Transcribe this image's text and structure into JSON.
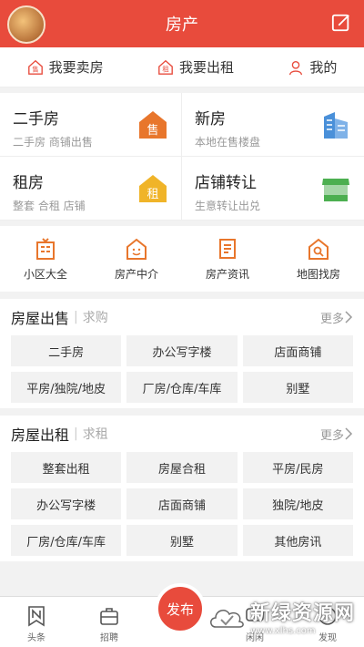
{
  "header": {
    "title": "房产"
  },
  "quick": [
    {
      "label": "我要卖房"
    },
    {
      "label": "我要出租"
    },
    {
      "label": "我的"
    }
  ],
  "grid": [
    {
      "title": "二手房",
      "sub": "二手房 商铺出售",
      "icon_text": "售"
    },
    {
      "title": "新房",
      "sub": "本地在售楼盘"
    },
    {
      "title": "租房",
      "sub": "整套 合租 店铺",
      "icon_text": "租"
    },
    {
      "title": "店铺转让",
      "sub": "生意转让出兑"
    }
  ],
  "nav4": [
    {
      "label": "小区大全"
    },
    {
      "label": "房产中介"
    },
    {
      "label": "房产资讯"
    },
    {
      "label": "地图找房"
    }
  ],
  "sale": {
    "title": "房屋出售",
    "sub": "求购",
    "more": "更多",
    "chips": [
      "二手房",
      "办公写字楼",
      "店面商铺",
      "平房/独院/地皮",
      "厂房/仓库/车库",
      "别墅"
    ]
  },
  "rent": {
    "title": "房屋出租",
    "sub": "求租",
    "more": "更多",
    "chips": [
      "整套出租",
      "房屋合租",
      "平房/民房",
      "办公写字楼",
      "店面商铺",
      "独院/地皮",
      "厂房/仓库/车库",
      "别墅",
      "其他房讯"
    ]
  },
  "tabbar": {
    "items": [
      {
        "label": "头条"
      },
      {
        "label": "招聘"
      },
      {
        "label": "闲闲"
      },
      {
        "label": "发现"
      }
    ],
    "publish": "发布"
  },
  "watermark": {
    "title": "新绿资源网",
    "url": "www.xlhs.com"
  },
  "colors": {
    "accent": "#e84b3c",
    "orange": "#e8762c",
    "yellow": "#f0b429",
    "blue": "#4a90d9",
    "green": "#4caf50"
  }
}
